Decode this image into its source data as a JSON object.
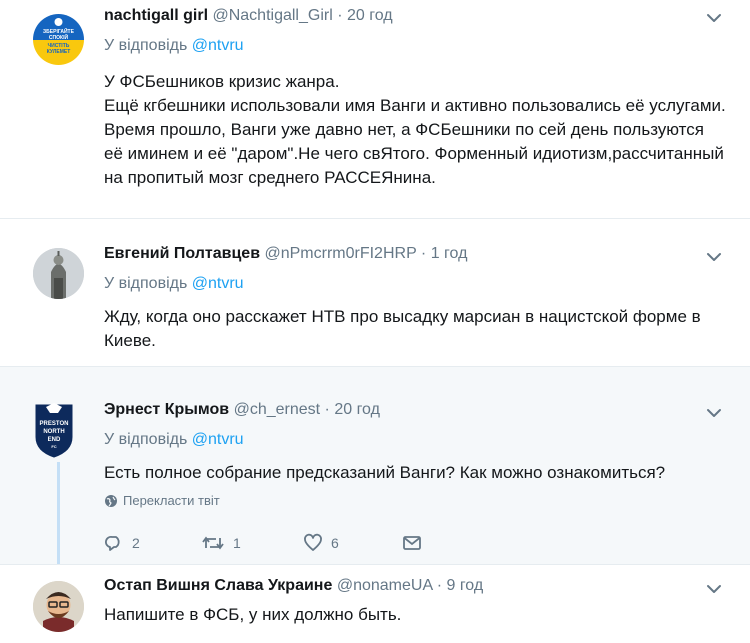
{
  "tweets": [
    {
      "name": "nachtigall girl",
      "handle": "@Nachtigall_Girl",
      "separator": "·",
      "time": "20 год",
      "reply_prefix": "У відповідь ",
      "reply_to": "@ntvru",
      "avatar_text": [
        "ЗБЕРІГАЙТЕ",
        "СПОКІЙ",
        "ЧИСТІТЬ",
        "КУЛЕМЕТ"
      ],
      "lines": [
        "У ФСБешников кризис жанра.",
        "Ещё кгбешники использовали имя Ванги и активно пользовались её услугами.",
        "Время прошло, Ванги уже давно нет, а ФСБешники  по сей день пользуются",
        "её иминем и её \"даром\".Не чего свЯтого. Форменный идиотизм,рассчитанный",
        "на пропитый мозг среднего РАССЕЯнина."
      ]
    },
    {
      "name": "Евгений Полтавцев",
      "handle": "@nPmcrrm0rFI2HRP",
      "separator": "·",
      "time": "1 год",
      "reply_prefix": "У відповідь ",
      "reply_to": "@ntvru",
      "lines": [
        "Жду, когда оно расскажет НТВ про высадку марсиан в нацистской форме в",
        "Киеве."
      ]
    },
    {
      "name": "Эрнест Крымов",
      "handle": "@ch_ernest",
      "separator": "·",
      "time": "20 год",
      "reply_prefix": "У відповідь ",
      "reply_to": "@ntvru",
      "avatar_text": [
        "PRESTON",
        "NORTH",
        "END",
        "FC"
      ],
      "lines": [
        "Есть полное собрание предсказаний Ванги? Как можно ознакомиться?"
      ],
      "translate_label": "Перекласти твіт",
      "actions": {
        "replies": "2",
        "retweets": "1",
        "likes": "6"
      }
    },
    {
      "name": "Остап Вишня Слава Украине",
      "handle": "@nonameUA",
      "separator": "·",
      "time": "9 год",
      "lines": [
        "Напишите в ФСБ, у них должно быть."
      ]
    }
  ],
  "colors": {
    "link": "#1da1f2",
    "secondary": "#657786",
    "highlight_bg": "#f5f8fa",
    "thread_line": "#c4dff6"
  },
  "icons": [
    "chevron-down-icon",
    "globe-icon",
    "reply-icon",
    "retweet-icon",
    "like-icon",
    "dm-icon"
  ]
}
